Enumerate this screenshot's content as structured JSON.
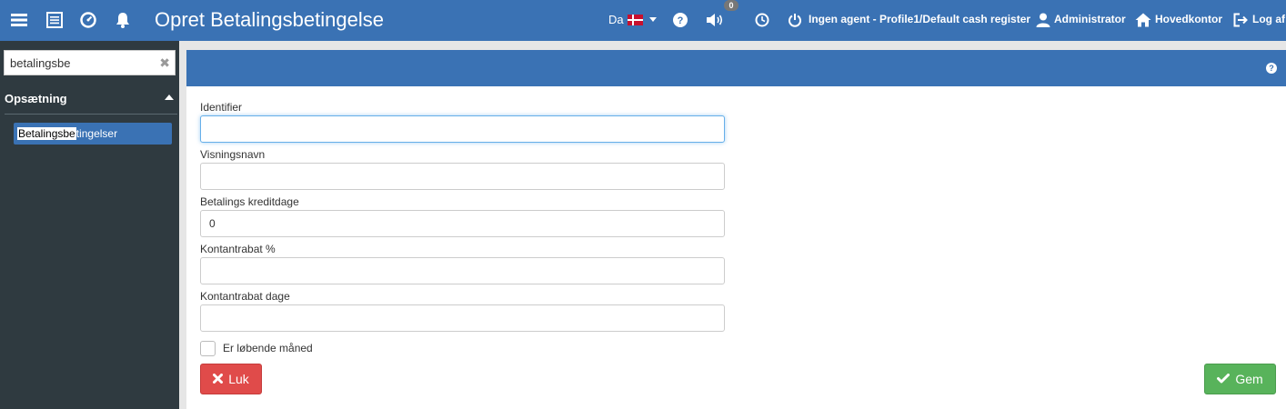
{
  "topbar": {
    "title": "Opret Betalingsbetingelse",
    "language": "Da",
    "notification_count": "0",
    "agent_status": "Ingen agent - Profile1/Default cash register",
    "user": "Administrator",
    "location": "Hovedkontor",
    "logout": "Log af",
    "icons": [
      "menu-icon",
      "list-icon",
      "dashboard-icon",
      "bell-icon",
      "help-icon",
      "speaker-icon",
      "clock-icon",
      "power-icon",
      "user-icon",
      "home-icon",
      "logout-icon"
    ]
  },
  "sidebar": {
    "search": {
      "value": "betalingsbe",
      "placeholder": ""
    },
    "section": "Opsætning",
    "items": [
      {
        "label_match": "Betalingsbe",
        "label_rest": "tingelser"
      }
    ]
  },
  "form": {
    "fields": [
      {
        "label": "Identifier",
        "value": ""
      },
      {
        "label": "Visningsnavn",
        "value": ""
      },
      {
        "label": "Betalings kreditdage",
        "value": "0"
      },
      {
        "label": "Kontantrabat %",
        "value": ""
      },
      {
        "label": "Kontantrabat dage",
        "value": ""
      }
    ],
    "checkbox_label": "Er løbende måned",
    "checkbox_checked": false,
    "close_label": "Luk",
    "save_label": "Gem"
  },
  "colors": {
    "primary": "#3a72b4",
    "sidebar": "#2f3a40",
    "danger": "#e04b4a",
    "success": "#58b35b"
  }
}
